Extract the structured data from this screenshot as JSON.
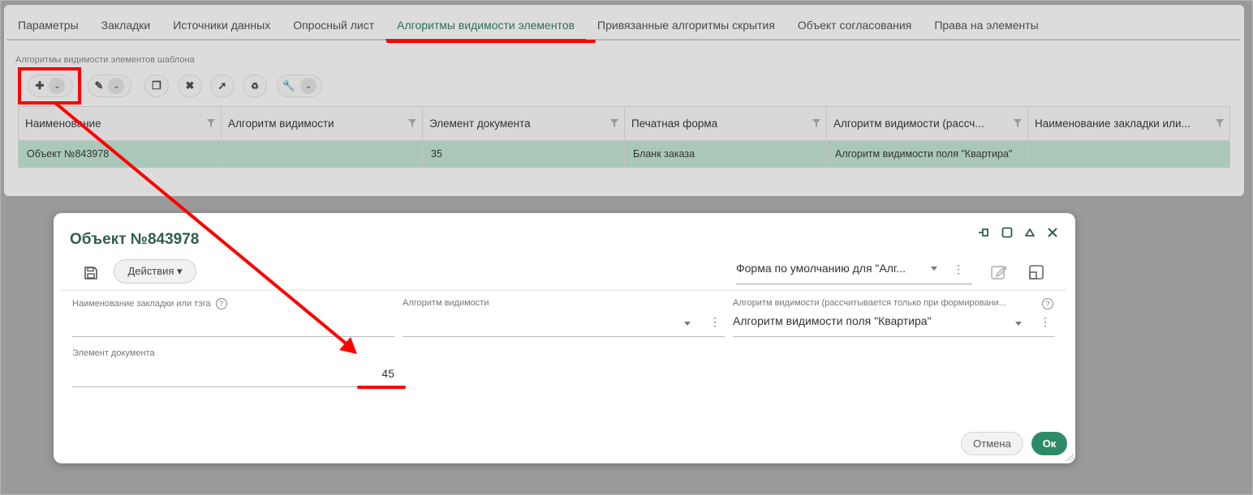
{
  "tabs": [
    {
      "label": "Параметры"
    },
    {
      "label": "Закладки"
    },
    {
      "label": "Источники данных"
    },
    {
      "label": "Опросный лист"
    },
    {
      "label": "Алгоритмы видимости элементов"
    },
    {
      "label": "Привязанные алгоритмы скрытия"
    },
    {
      "label": "Объект согласования"
    },
    {
      "label": "Права на элементы"
    }
  ],
  "active_tab": "Алгоритмы видимости элементов",
  "section_title": "Алгоритмы видимости элементов шаблона",
  "grid": {
    "columns": [
      "Наименование",
      "Алгоритм видимости",
      "Элемент документа",
      "Печатная форма",
      "Алгоритм видимости (рассч...",
      "Наименование закладки или..."
    ],
    "rows": [
      [
        "Объект №843978",
        "",
        "35",
        "Бланк заказа",
        "Алгоритм видимости поля \"Квартира\"",
        ""
      ]
    ]
  },
  "dialog": {
    "title": "Объект №843978",
    "actions_label": "Действия ▾",
    "form_select": "Форма по умолчанию для \"Алг...",
    "fields": {
      "tab_name_label": "Наименование закладки или тэга",
      "tab_name_value": "",
      "algorithm_label": "Алгоритм видимости",
      "algorithm_value": "",
      "algorithm_print_label": "Алгоритм видимости (рассчитывается только при формировани...",
      "algorithm_print_value": "Алгоритм видимости поля \"Квартира\"",
      "element_label": "Элемент документа",
      "element_value": "45"
    },
    "cancel_label": "Отмена",
    "ok_label": "Ок"
  },
  "colors": {
    "accent": "#2f6e5c",
    "annotation": "#ff0000",
    "ok_button": "#2e8b68",
    "selected_row": "#a9c8b9"
  }
}
